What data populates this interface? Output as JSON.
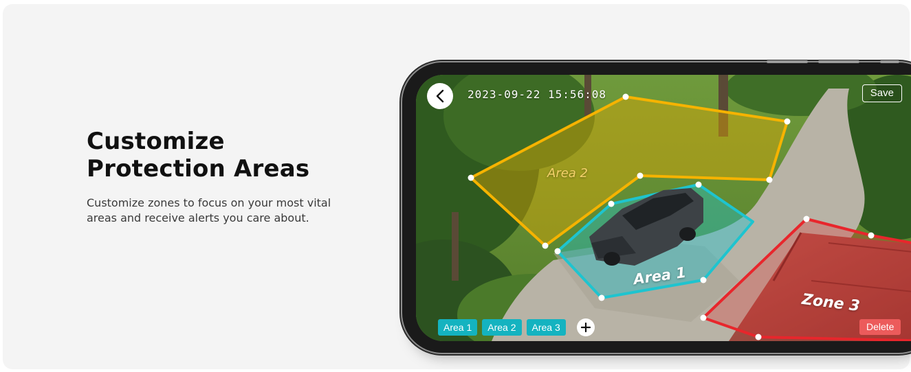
{
  "headline": {
    "line1": "Customize",
    "line2": "Protection Areas"
  },
  "subtext": {
    "line1": "Customize zones to focus on your most vital",
    "line2": "areas and receive alerts you care about."
  },
  "app": {
    "timestamp": "2023-09-22 15:56:08",
    "save_label": "Save",
    "back_icon": "chevron-left-icon",
    "add_icon": "plus-icon",
    "area_tabs": [
      "Area 1",
      "Area 2",
      "Area 3"
    ],
    "delete_label": "Delete",
    "zones": [
      {
        "label": "Area 2",
        "color": "#f6b300"
      },
      {
        "label": "Area 1",
        "color": "#1ec4cf"
      },
      {
        "label": "Zone 3",
        "color": "#e8262c"
      }
    ]
  },
  "colors": {
    "accent_teal": "#14b3c0",
    "delete_red": "#ec5b5b",
    "background": "#f4f4f4"
  }
}
